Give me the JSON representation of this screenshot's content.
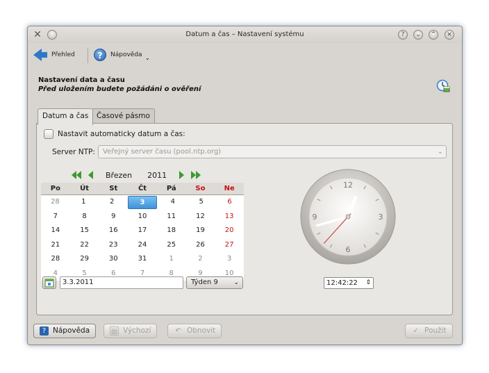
{
  "window": {
    "title": "Datum a čas – Nastavení systému"
  },
  "toolbar": {
    "overview_label": "Přehled",
    "help_label": "Nápověda"
  },
  "header": {
    "title": "Nastavení data a času",
    "subtitle": "Před uložením budete požádáni o ověření"
  },
  "tabs": [
    {
      "label": "Datum a čas",
      "active": true
    },
    {
      "label": "Časové pásmo",
      "active": false
    }
  ],
  "auto_set": {
    "label": "Nastavit automaticky datum a čas:",
    "checked": false
  },
  "ntp": {
    "label": "Server NTP:",
    "value": "Veřejný server času (pool.ntp.org)"
  },
  "calendar": {
    "month": "Březen",
    "year": "2011",
    "weekdays": [
      "Po",
      "Út",
      "St",
      "Čt",
      "Pá",
      "So",
      "Ne"
    ],
    "weeks": [
      [
        {
          "d": "28",
          "o": true
        },
        {
          "d": "1"
        },
        {
          "d": "2"
        },
        {
          "d": "3",
          "sel": true
        },
        {
          "d": "4"
        },
        {
          "d": "5"
        },
        {
          "d": "6",
          "sun": true
        }
      ],
      [
        {
          "d": "7"
        },
        {
          "d": "8"
        },
        {
          "d": "9"
        },
        {
          "d": "10"
        },
        {
          "d": "11"
        },
        {
          "d": "12"
        },
        {
          "d": "13",
          "sun": true
        }
      ],
      [
        {
          "d": "14"
        },
        {
          "d": "15"
        },
        {
          "d": "16"
        },
        {
          "d": "17"
        },
        {
          "d": "18"
        },
        {
          "d": "19"
        },
        {
          "d": "20",
          "sun": true
        }
      ],
      [
        {
          "d": "21"
        },
        {
          "d": "22"
        },
        {
          "d": "23"
        },
        {
          "d": "24"
        },
        {
          "d": "25"
        },
        {
          "d": "26"
        },
        {
          "d": "27",
          "sun": true
        }
      ],
      [
        {
          "d": "28"
        },
        {
          "d": "29"
        },
        {
          "d": "30"
        },
        {
          "d": "31"
        },
        {
          "d": "1",
          "o": true
        },
        {
          "d": "2",
          "o": true
        },
        {
          "d": "3",
          "o": true
        }
      ],
      [
        {
          "d": "4",
          "o": true
        },
        {
          "d": "5",
          "o": true
        },
        {
          "d": "6",
          "o": true
        },
        {
          "d": "7",
          "o": true
        },
        {
          "d": "8",
          "o": true
        },
        {
          "d": "9",
          "o": true
        },
        {
          "d": "10",
          "o": true
        }
      ]
    ],
    "date_value": "3.3.2011",
    "week_value": "Týden 9"
  },
  "clock": {
    "numerals": [
      "12",
      "3",
      "6",
      "9"
    ],
    "time_value": "12:42:22",
    "hours": 12,
    "minutes": 42,
    "seconds": 22
  },
  "buttons": {
    "help": "Nápověda",
    "defaults": "Výchozí",
    "reset": "Obnovit",
    "apply": "Použít"
  },
  "colors": {
    "accent": "#3f92d8",
    "weekend": "#c81010",
    "nav_arrow": "#3d9b2e",
    "second_hand": "#c84a4a"
  }
}
